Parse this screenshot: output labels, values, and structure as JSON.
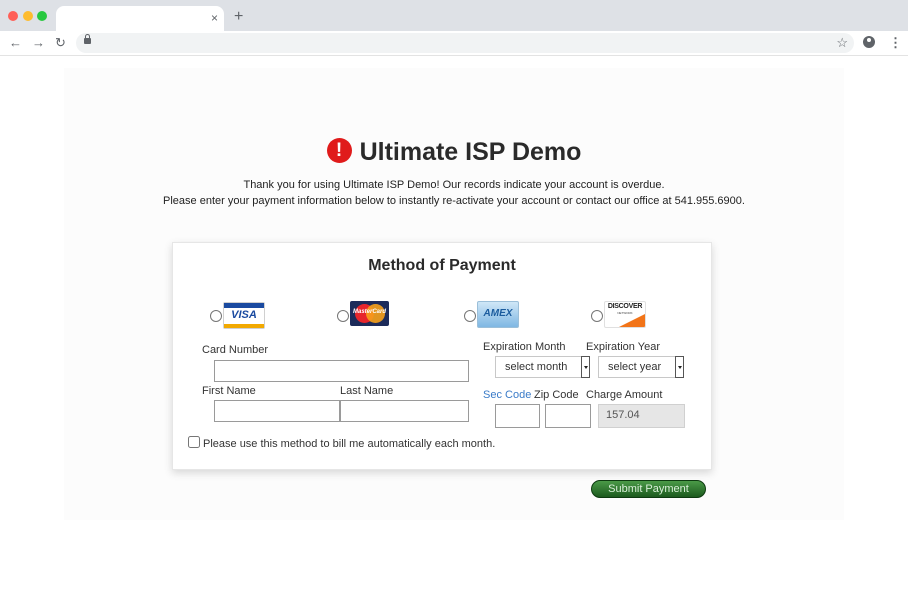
{
  "browser": {
    "tab_close": "×",
    "new_tab": "+",
    "back": "←",
    "forward": "→",
    "reload": "↻",
    "star": "☆",
    "menu": "⋮"
  },
  "page": {
    "title": "Ultimate ISP Demo",
    "alert_icon": "!",
    "message_line1": "Thank you for using Ultimate ISP Demo! Our records indicate your account is overdue.",
    "message_line2": "Please enter your payment information below to instantly re-activate your account or contact our office at 541.955.6900."
  },
  "payment": {
    "heading": "Method of Payment",
    "cards": {
      "visa": "VISA",
      "mastercard": "MasterCard",
      "amex": "AMEX",
      "discover": "DISCOVER",
      "discover_sub": "NETWORK"
    },
    "labels": {
      "card_number": "Card Number",
      "first_name": "First Name",
      "last_name": "Last Name",
      "expiration_month": "Expiration Month",
      "expiration_year": "Expiration Year",
      "sec_code": "Sec Code",
      "zip_code": "Zip Code",
      "charge_amount": "Charge Amount"
    },
    "month_select": "select month",
    "year_select": "select year",
    "charge_amount_value": "157.04",
    "auto_bill_label": "Please use this method to bill me automatically each month.",
    "submit_label": "Submit Payment"
  }
}
